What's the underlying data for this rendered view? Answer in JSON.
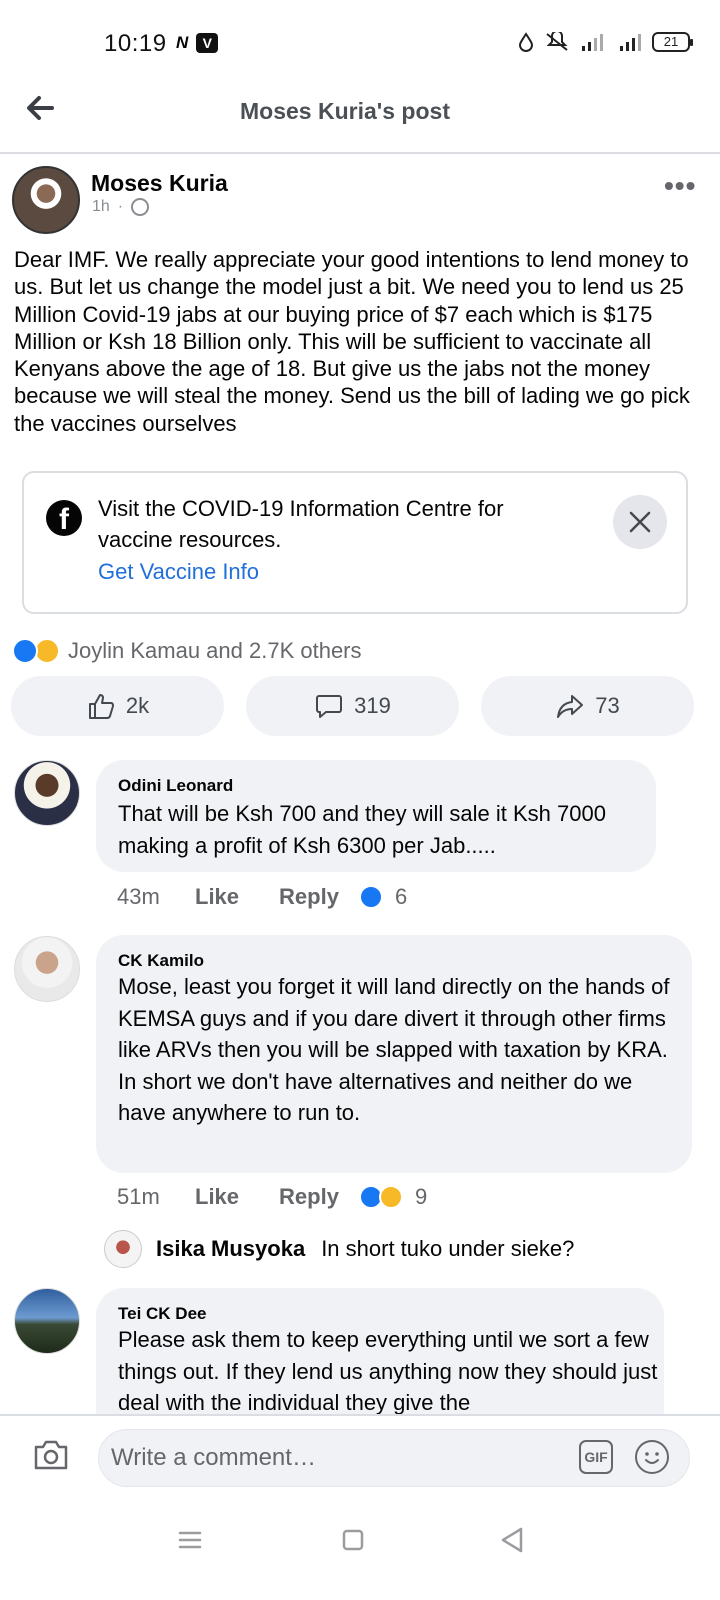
{
  "status_bar": {
    "time": "10:19",
    "left_icons": [
      "N",
      "V"
    ],
    "battery": "21"
  },
  "header": {
    "title": "Moses Kuria's post"
  },
  "post": {
    "author": "Moses Kuria",
    "time": "1h",
    "separator": "·",
    "more": "•••",
    "text": "Dear IMF. We really appreciate your good intentions to lend money to us. But let us change the model just a bit. We need you to lend us 25 Million Covid-19 jabs at our buying price of $7 each which is $175 Million or Ksh 18 Billion only. This will be sufficient to vaccinate all Kenyans above the age of 18. But give us the jabs not the money because we will steal the money. Send us the bill of lading we go pick the vaccines ourselves"
  },
  "covid_card": {
    "icon": "f",
    "text": "Visit the COVID-19 Information Centre for vaccine resources.",
    "link": "Get Vaccine Info"
  },
  "reactions": {
    "summary": "Joylin Kamau and 2.7K others"
  },
  "actions": {
    "like_count": "2k",
    "comment_count": "319",
    "share_count": "73"
  },
  "comments": [
    {
      "name": "Odini Leonard",
      "text": "That will be Ksh 700 and they will sale it Ksh 7000 making a profit of Ksh 6300 per Jab.....",
      "time": "43m",
      "like_label": "Like",
      "reply_label": "Reply",
      "reaction_count": "6"
    },
    {
      "name": "CK Kamilo",
      "text": "Mose, least you forget it will land directly on the hands of KEMSA guys and if you dare divert it through other firms like ARVs then you will be slapped with taxation by KRA.  In short we don't have alternatives and neither do we have anywhere to run to.",
      "time": "51m",
      "like_label": "Like",
      "reply_label": "Reply",
      "reaction_count": "9"
    },
    {
      "name": "Tei CK Dee",
      "text": "Please ask them to keep everything until we sort a few things out. If they lend us anything now they should just deal with the individual they give the"
    }
  ],
  "reply_preview": {
    "name": "Isika Musyoka",
    "text": "In short tuko under sieke?"
  },
  "composer": {
    "placeholder": "Write a comment…",
    "gif_label": "GIF"
  },
  "colors": {
    "accent": "#1877f2",
    "link": "#216fdb",
    "bubble": "#f0f2f5",
    "muted": "#65676b"
  }
}
